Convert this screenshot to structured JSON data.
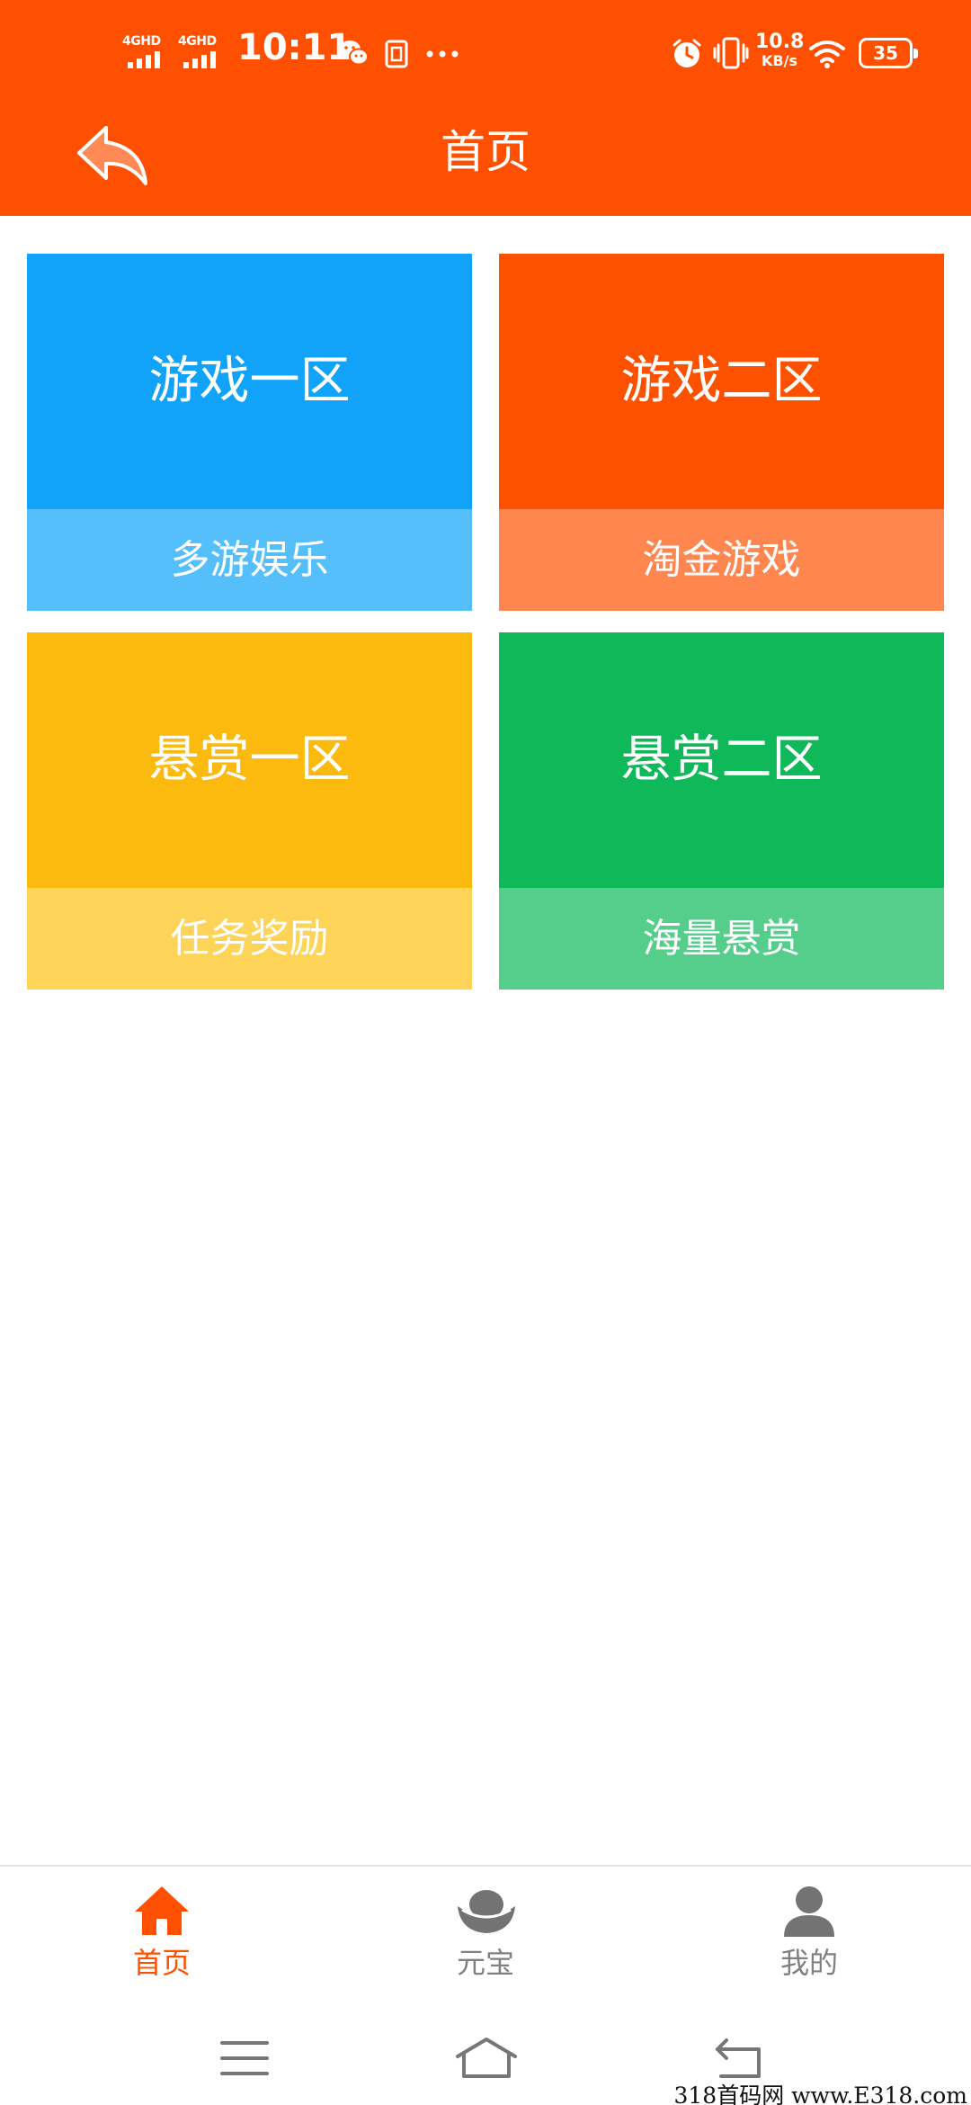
{
  "status_bar": {
    "network1": "4GHD",
    "network2": "4GHD",
    "time": "10:11",
    "net_speed_value": "10.8",
    "net_speed_unit": "KB/s",
    "battery": "35",
    "icons": [
      "wechat-icon",
      "sim-card-icon",
      "more-dots-icon",
      "alarm-icon",
      "vibrate-icon",
      "wifi-icon",
      "battery-icon"
    ]
  },
  "header": {
    "title": "首页",
    "back_icon": "back-arrow-icon",
    "background": "#fe5000"
  },
  "tiles": [
    {
      "title": "游戏一区",
      "subtitle": "多游娱乐",
      "color": "#10a3f9",
      "sub_color": "#55bffb"
    },
    {
      "title": "游戏二区",
      "subtitle": "淘金游戏",
      "color": "#fe5100",
      "sub_color": "#ff864e"
    },
    {
      "title": "悬赏一区",
      "subtitle": "任务奖励",
      "color": "#fdba0e",
      "sub_color": "#fdd358"
    },
    {
      "title": "悬赏二区",
      "subtitle": "海量悬赏",
      "color": "#0fb858",
      "sub_color": "#56ce8b"
    }
  ],
  "bottom_nav": {
    "items": [
      {
        "label": "首页",
        "icon": "home-icon",
        "active": true
      },
      {
        "label": "元宝",
        "icon": "ingot-icon",
        "active": false
      },
      {
        "label": "我的",
        "icon": "user-icon",
        "active": false
      }
    ],
    "active_color": "#fe5000",
    "inactive_color": "#808080"
  },
  "system_nav": {
    "icons": [
      "menu-icon",
      "home-outline-icon",
      "back-icon"
    ]
  },
  "watermark": "318首码网 www.E318.com"
}
